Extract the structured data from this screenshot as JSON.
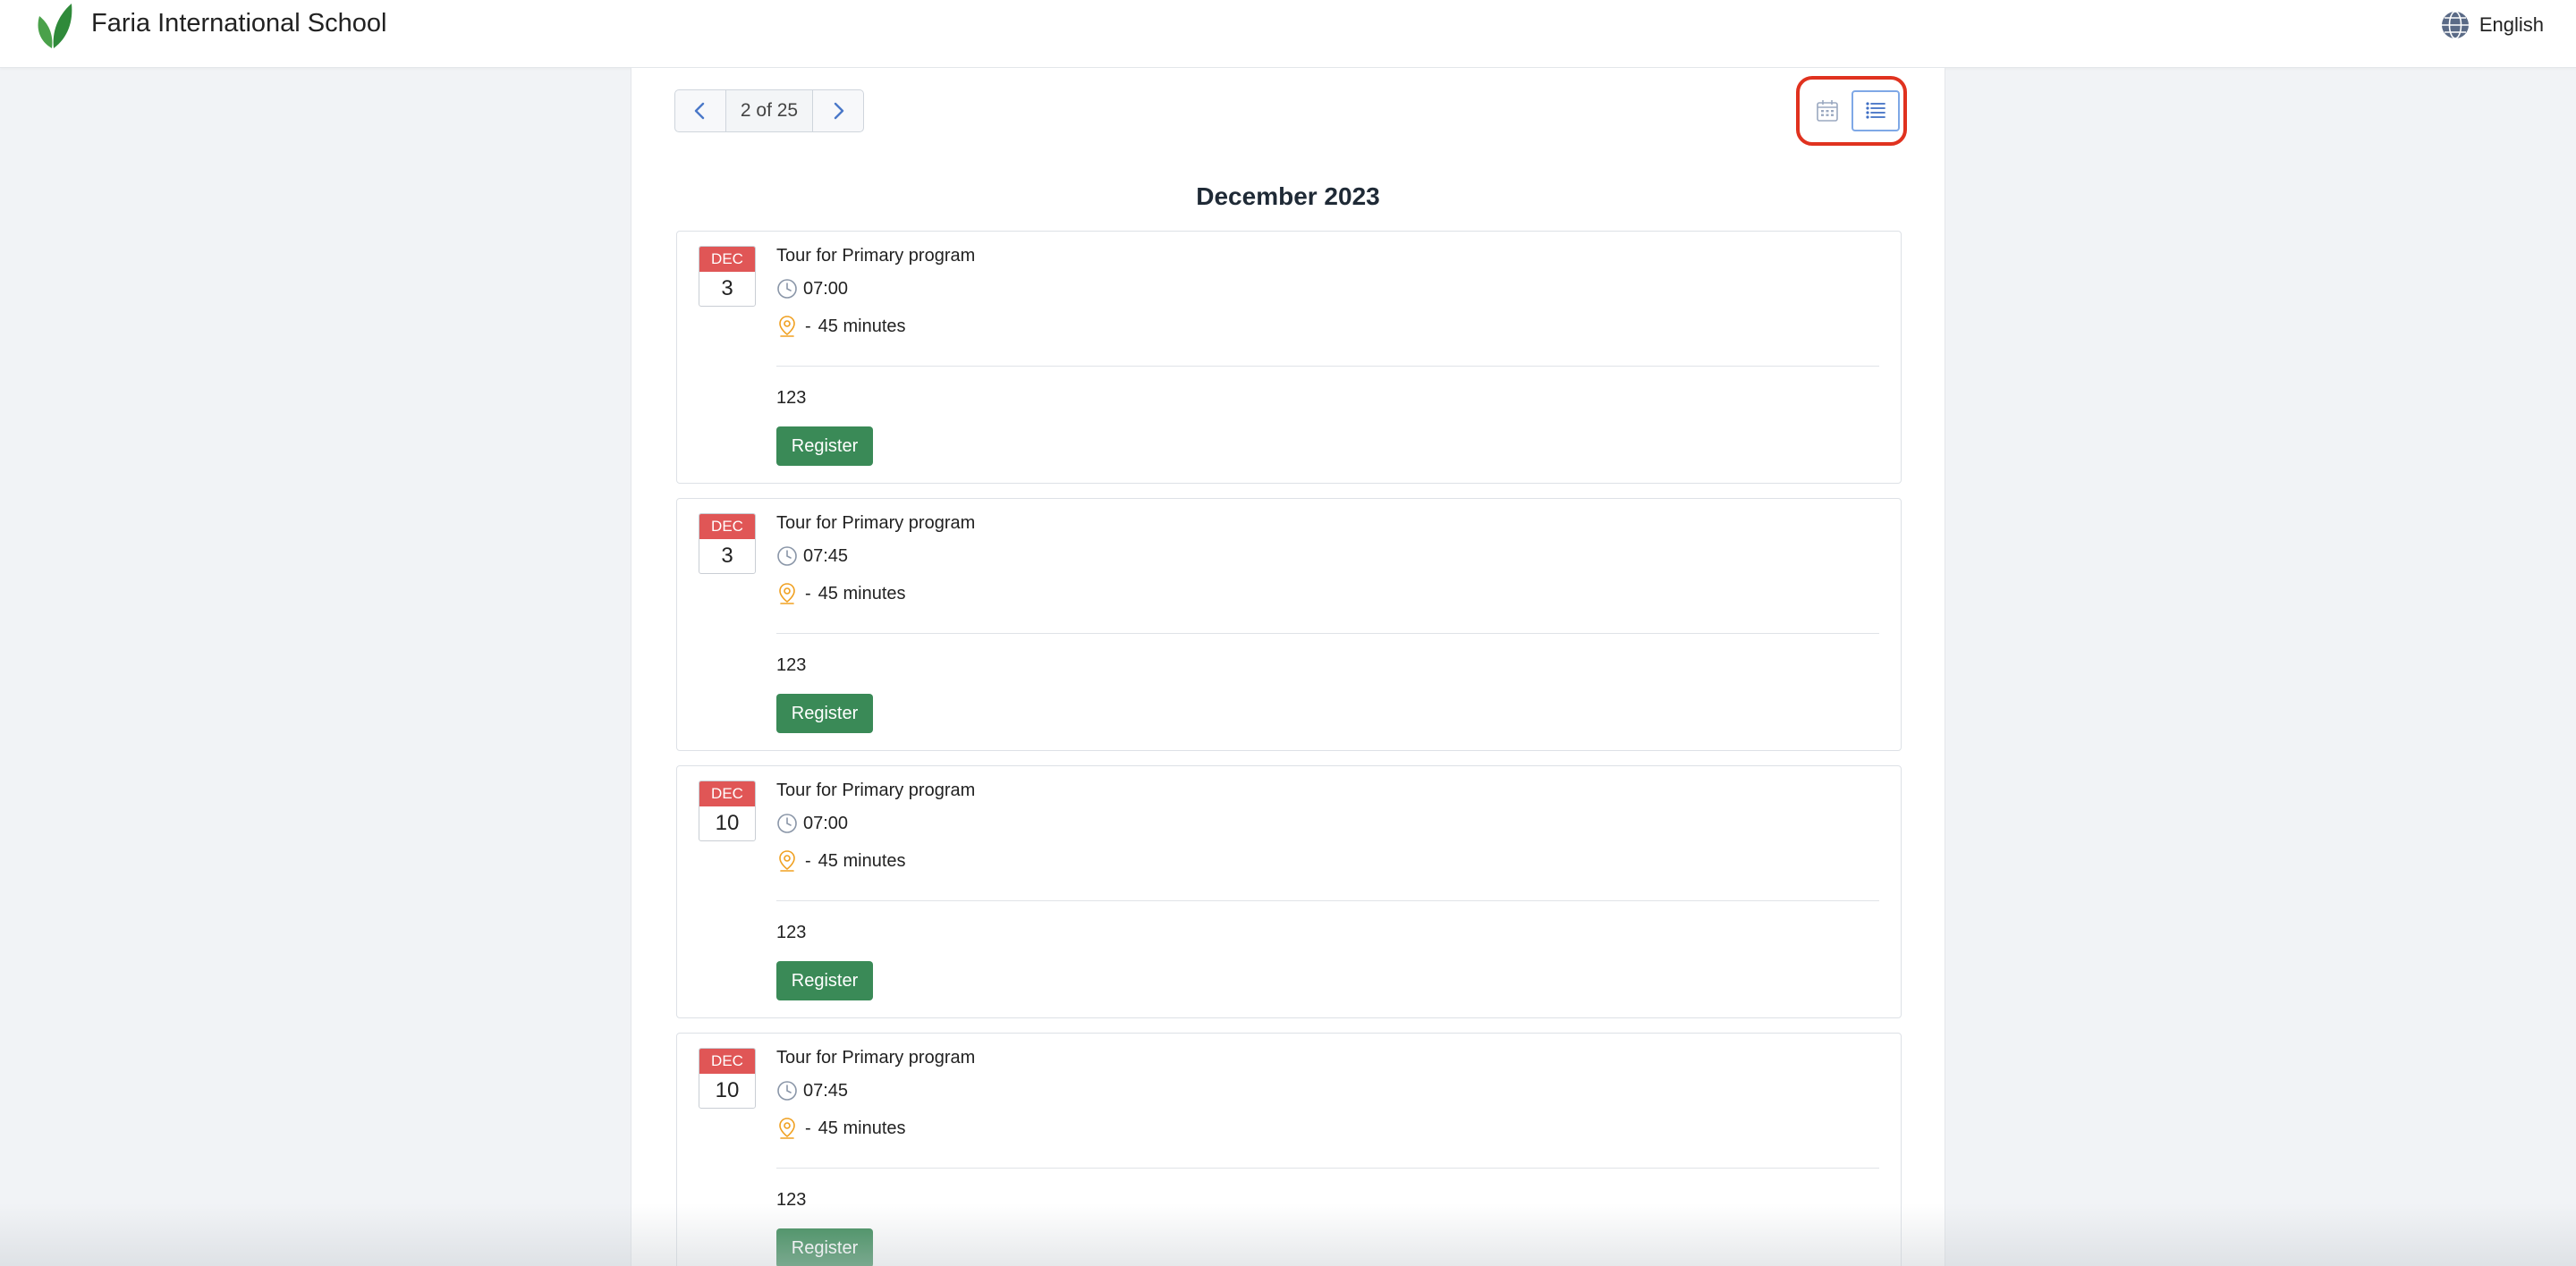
{
  "header": {
    "school_name": "Faria International School",
    "logo_icon": "leaf-logo-icon",
    "language_label": "English",
    "language_icon": "globe-icon"
  },
  "pager": {
    "label": "2 of 25",
    "prev_icon": "chevron-left-icon",
    "next_icon": "chevron-right-icon"
  },
  "view_toggle": {
    "calendar_icon": "calendar-icon",
    "list_icon": "list-icon",
    "active": "list",
    "highlight_color": "#e0321f"
  },
  "month_title": "December 2023",
  "colors": {
    "date_badge": "#e05656",
    "register_button": "#3a8a57",
    "location_icon": "#f0a020"
  },
  "events": [
    {
      "month": "DEC",
      "day": "3",
      "title": "Tour for Primary program",
      "time": "07:00",
      "duration": "45 minutes",
      "description": "123",
      "register_label": "Register"
    },
    {
      "month": "DEC",
      "day": "3",
      "title": "Tour for Primary program",
      "time": "07:45",
      "duration": "45 minutes",
      "description": "123",
      "register_label": "Register"
    },
    {
      "month": "DEC",
      "day": "10",
      "title": "Tour for Primary program",
      "time": "07:00",
      "duration": "45 minutes",
      "description": "123",
      "register_label": "Register"
    },
    {
      "month": "DEC",
      "day": "10",
      "title": "Tour for Primary program",
      "time": "07:45",
      "duration": "45 minutes",
      "description": "123",
      "register_label": "Register"
    }
  ],
  "location_separator": "-"
}
